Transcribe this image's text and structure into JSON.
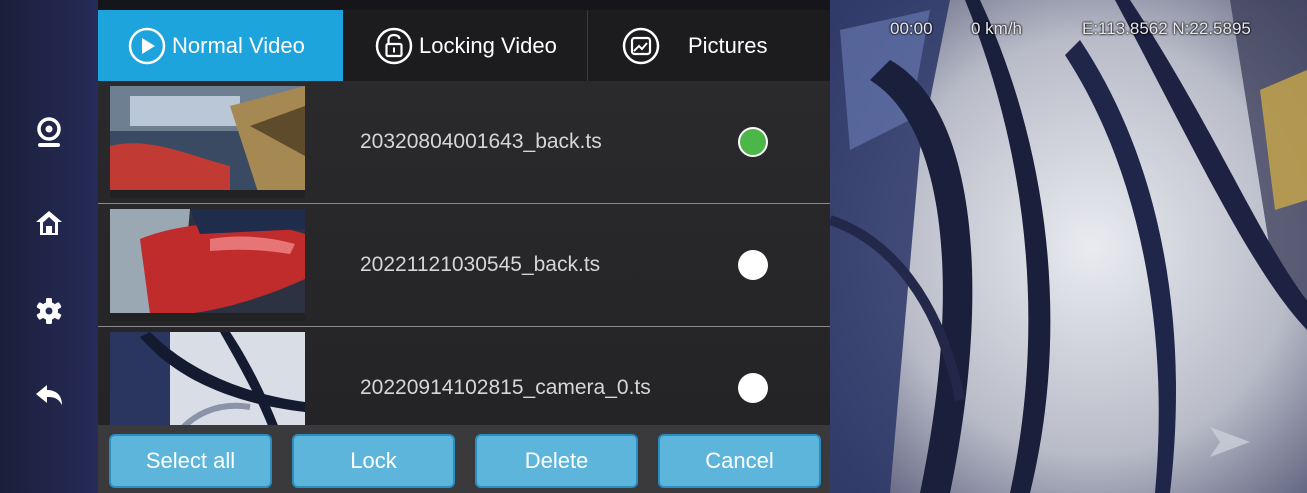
{
  "tabs": [
    {
      "label": "Normal Video",
      "icon": "play-icon",
      "active": true
    },
    {
      "label": "Locking Video",
      "icon": "lock-icon",
      "active": false
    },
    {
      "label": "Pictures",
      "icon": "picture-icon",
      "active": false
    }
  ],
  "sidebar": {
    "items": [
      {
        "icon": "camera-icon"
      },
      {
        "icon": "home-icon"
      },
      {
        "icon": "gear-icon"
      },
      {
        "icon": "back-icon"
      }
    ]
  },
  "files": [
    {
      "name": "20320804001643_back.ts",
      "selected": true
    },
    {
      "name": "20221121030545_back.ts",
      "selected": false
    },
    {
      "name": "20220914102815_camera_0.ts",
      "selected": false
    }
  ],
  "buttons": {
    "select_all": "Select all",
    "lock": "Lock",
    "delete": "Delete",
    "cancel": "Cancel"
  },
  "preview": {
    "time": "00:00",
    "speed": "0 km/h",
    "coords": "E:113.8562 N:22.5895"
  },
  "colors": {
    "accent": "#1ea4dc",
    "button": "#5eb5dc",
    "selected_radio": "#4cb648"
  }
}
